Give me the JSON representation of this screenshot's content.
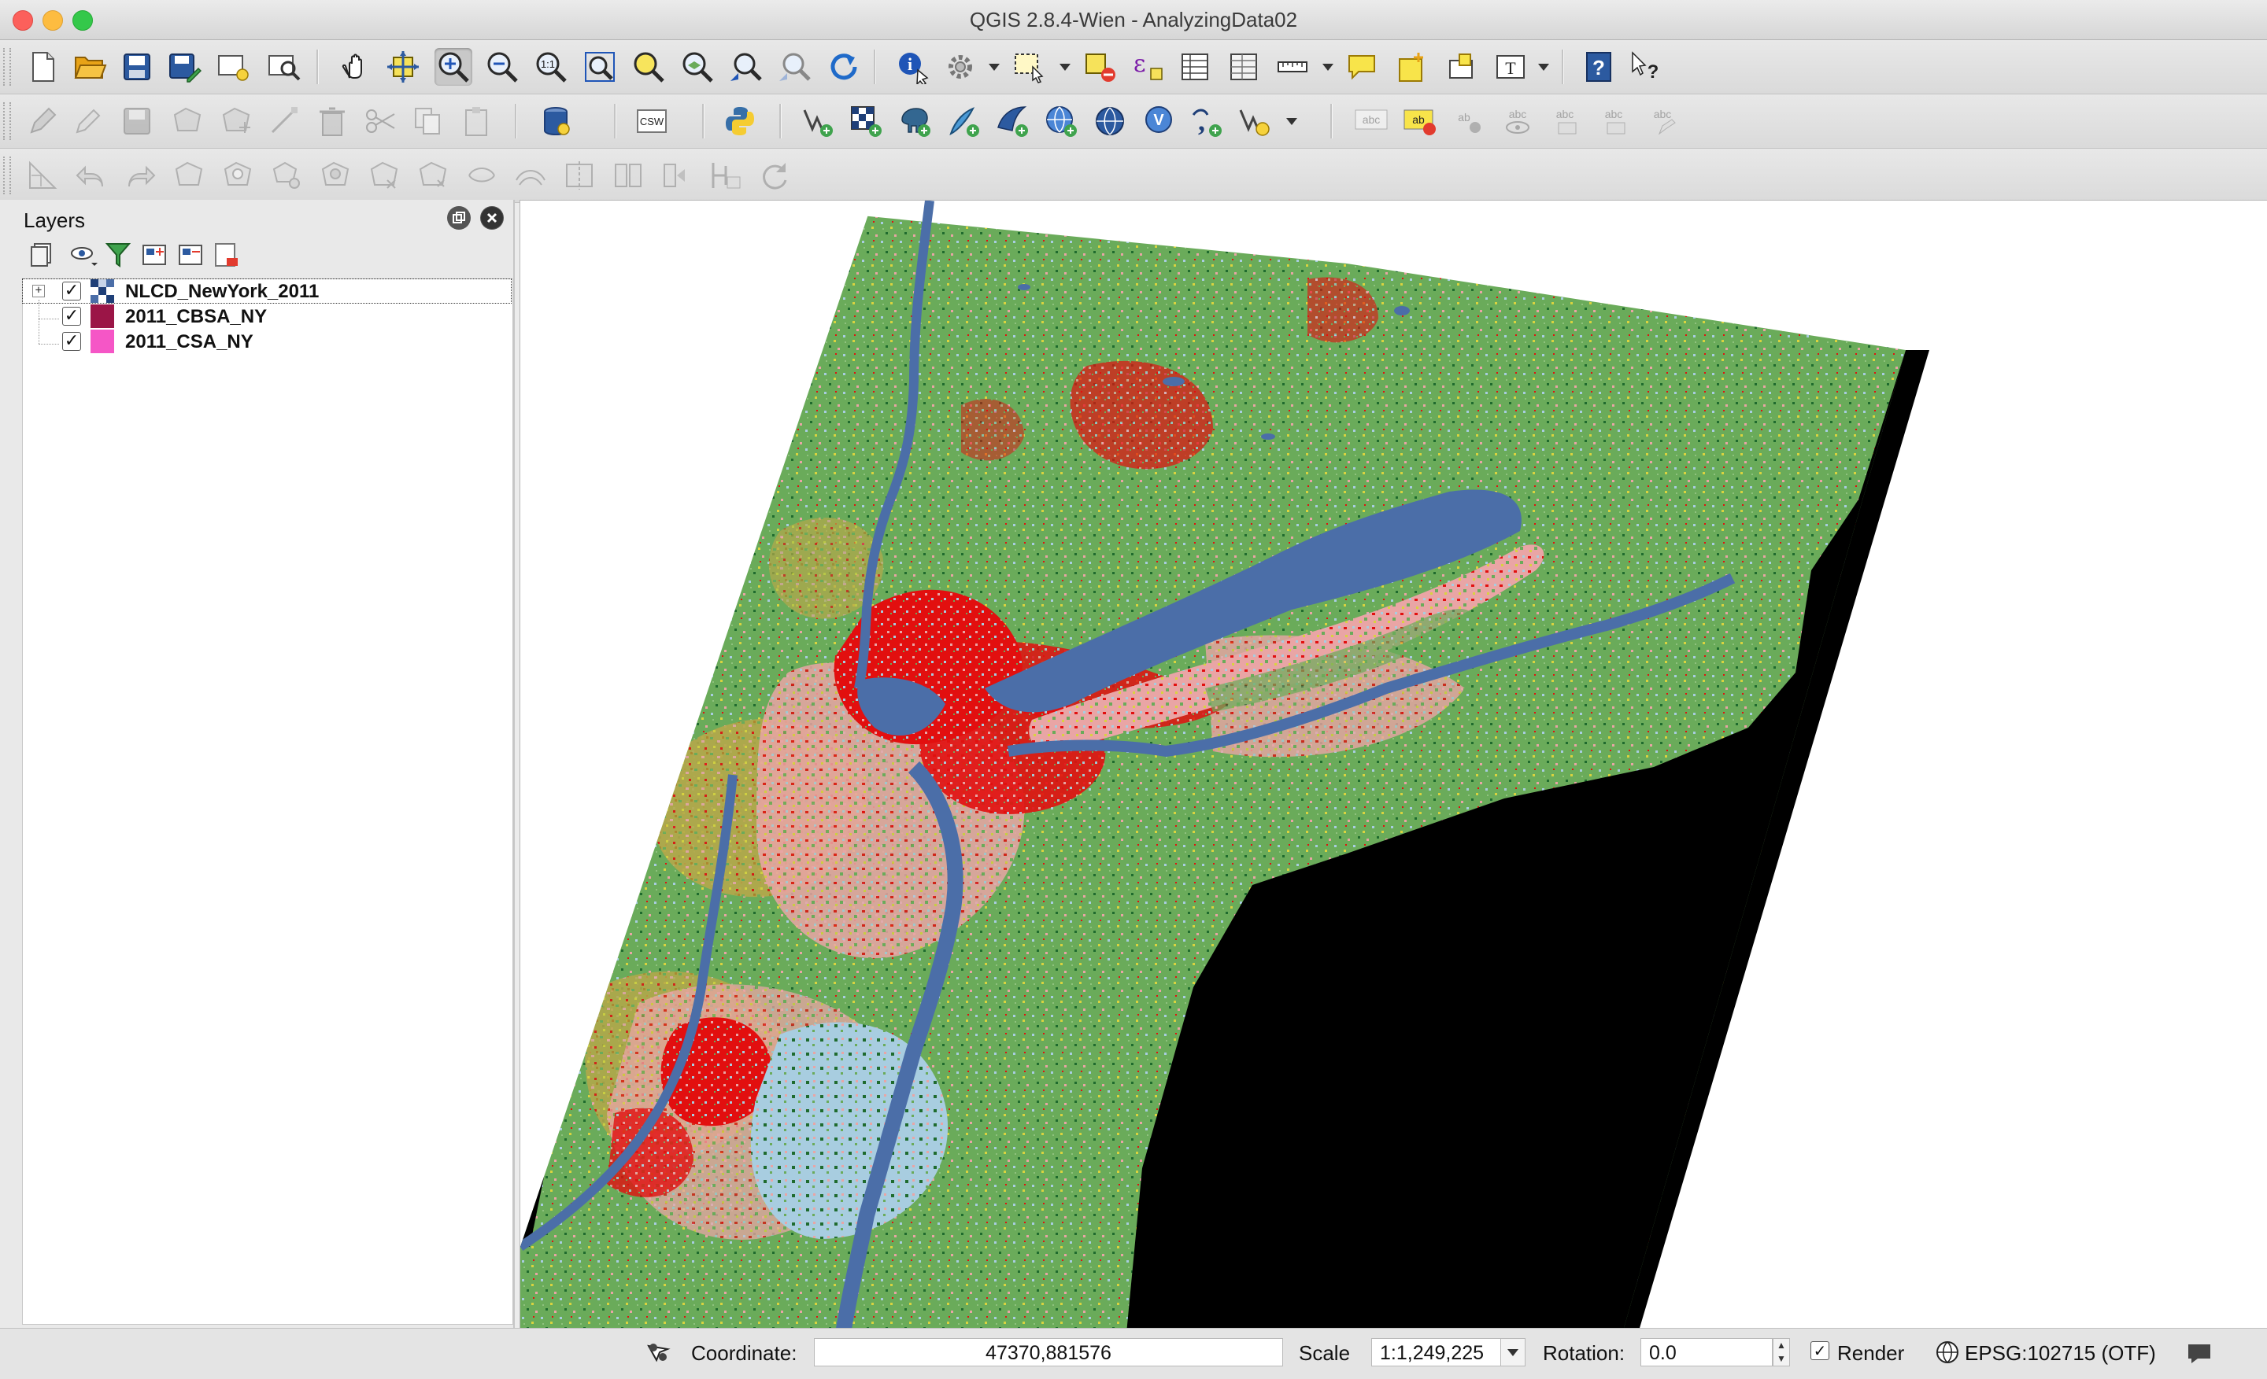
{
  "window": {
    "title": "QGIS 2.8.4-Wien - AnalyzingData02"
  },
  "toolbars": {
    "row1": [
      "new-project",
      "open-project",
      "save-project",
      "save-project-as",
      "new-print-composer",
      "composer-manager",
      "pan-map",
      "pan-to-selection",
      "zoom-in",
      "zoom-out",
      "zoom-actual-size",
      "zoom-full",
      "zoom-to-selection",
      "zoom-to-layer",
      "zoom-last",
      "zoom-next",
      "refresh",
      "identify-features",
      "run-feature-action",
      "select-features",
      "deselect-all",
      "field-calculator",
      "open-attribute-table",
      "statistical-summary",
      "measure-line",
      "map-tips",
      "new-bookmark",
      "show-bookmarks",
      "text-annotation",
      "help-contents",
      "whats-this"
    ],
    "row2": [
      "current-edits",
      "toggle-editing",
      "save-layer-edits",
      "add-feature",
      "move-feature",
      "node-tool",
      "delete-selected",
      "cut-features",
      "copy-features",
      "paste-features",
      "db-manager",
      "csw-client",
      "python-console",
      "add-vector-layer",
      "add-raster-layer",
      "add-postgis-layer",
      "add-spatialite-layer",
      "add-mssql-layer",
      "add-wms-layer",
      "add-wcs-layer",
      "add-wfs-layer",
      "add-delimited-text-layer",
      "new-shapefile-layer",
      "label-toolbar-1",
      "label-toolbar-2",
      "pin-labels",
      "show-hide-labels",
      "move-label",
      "rotate-label",
      "change-label"
    ],
    "row3": [
      "advanced-digitize",
      "undo",
      "redo",
      "simplify-feature",
      "add-ring",
      "add-part",
      "fill-ring",
      "delete-ring",
      "delete-part",
      "reshape-features",
      "offset-curve",
      "split-features",
      "split-parts",
      "merge-features",
      "merge-attributes",
      "rotate-point-symbols"
    ]
  },
  "layers_panel": {
    "title": "Layers",
    "layers": [
      {
        "name": "NLCD_NewYork_2011",
        "checked": true,
        "expand": "+",
        "swatch": "raster",
        "selected": true
      },
      {
        "name": "2011_CBSA_NY",
        "checked": true,
        "swatch_color": "#9b1547"
      },
      {
        "name": "2011_CSA_NY",
        "checked": true,
        "swatch_color": "#f556c6"
      }
    ],
    "checkmark": "✓"
  },
  "map": {
    "colors": {
      "forest": "#6aab5a",
      "deciduous": "#79b36a",
      "evergreen": "#1f6b2e",
      "pasture": "#d9d33f",
      "cultivated": "#b4832b",
      "developed": "#e20f0f",
      "developed_open": "#e9a5a5",
      "water": "#4b6ea8",
      "wetlands": "#a8cde0",
      "nodata": "#000000",
      "background": "#ffffff"
    }
  },
  "statusbar": {
    "coordinate_label": "Coordinate:",
    "coordinate_value": "47370,881576",
    "scale_label": "Scale",
    "scale_value": "1:1,249,225",
    "rotation_label": "Rotation:",
    "rotation_value": "0.0",
    "render_label": "Render",
    "render_checked": true,
    "crs_label": "EPSG:102715 (OTF)"
  }
}
